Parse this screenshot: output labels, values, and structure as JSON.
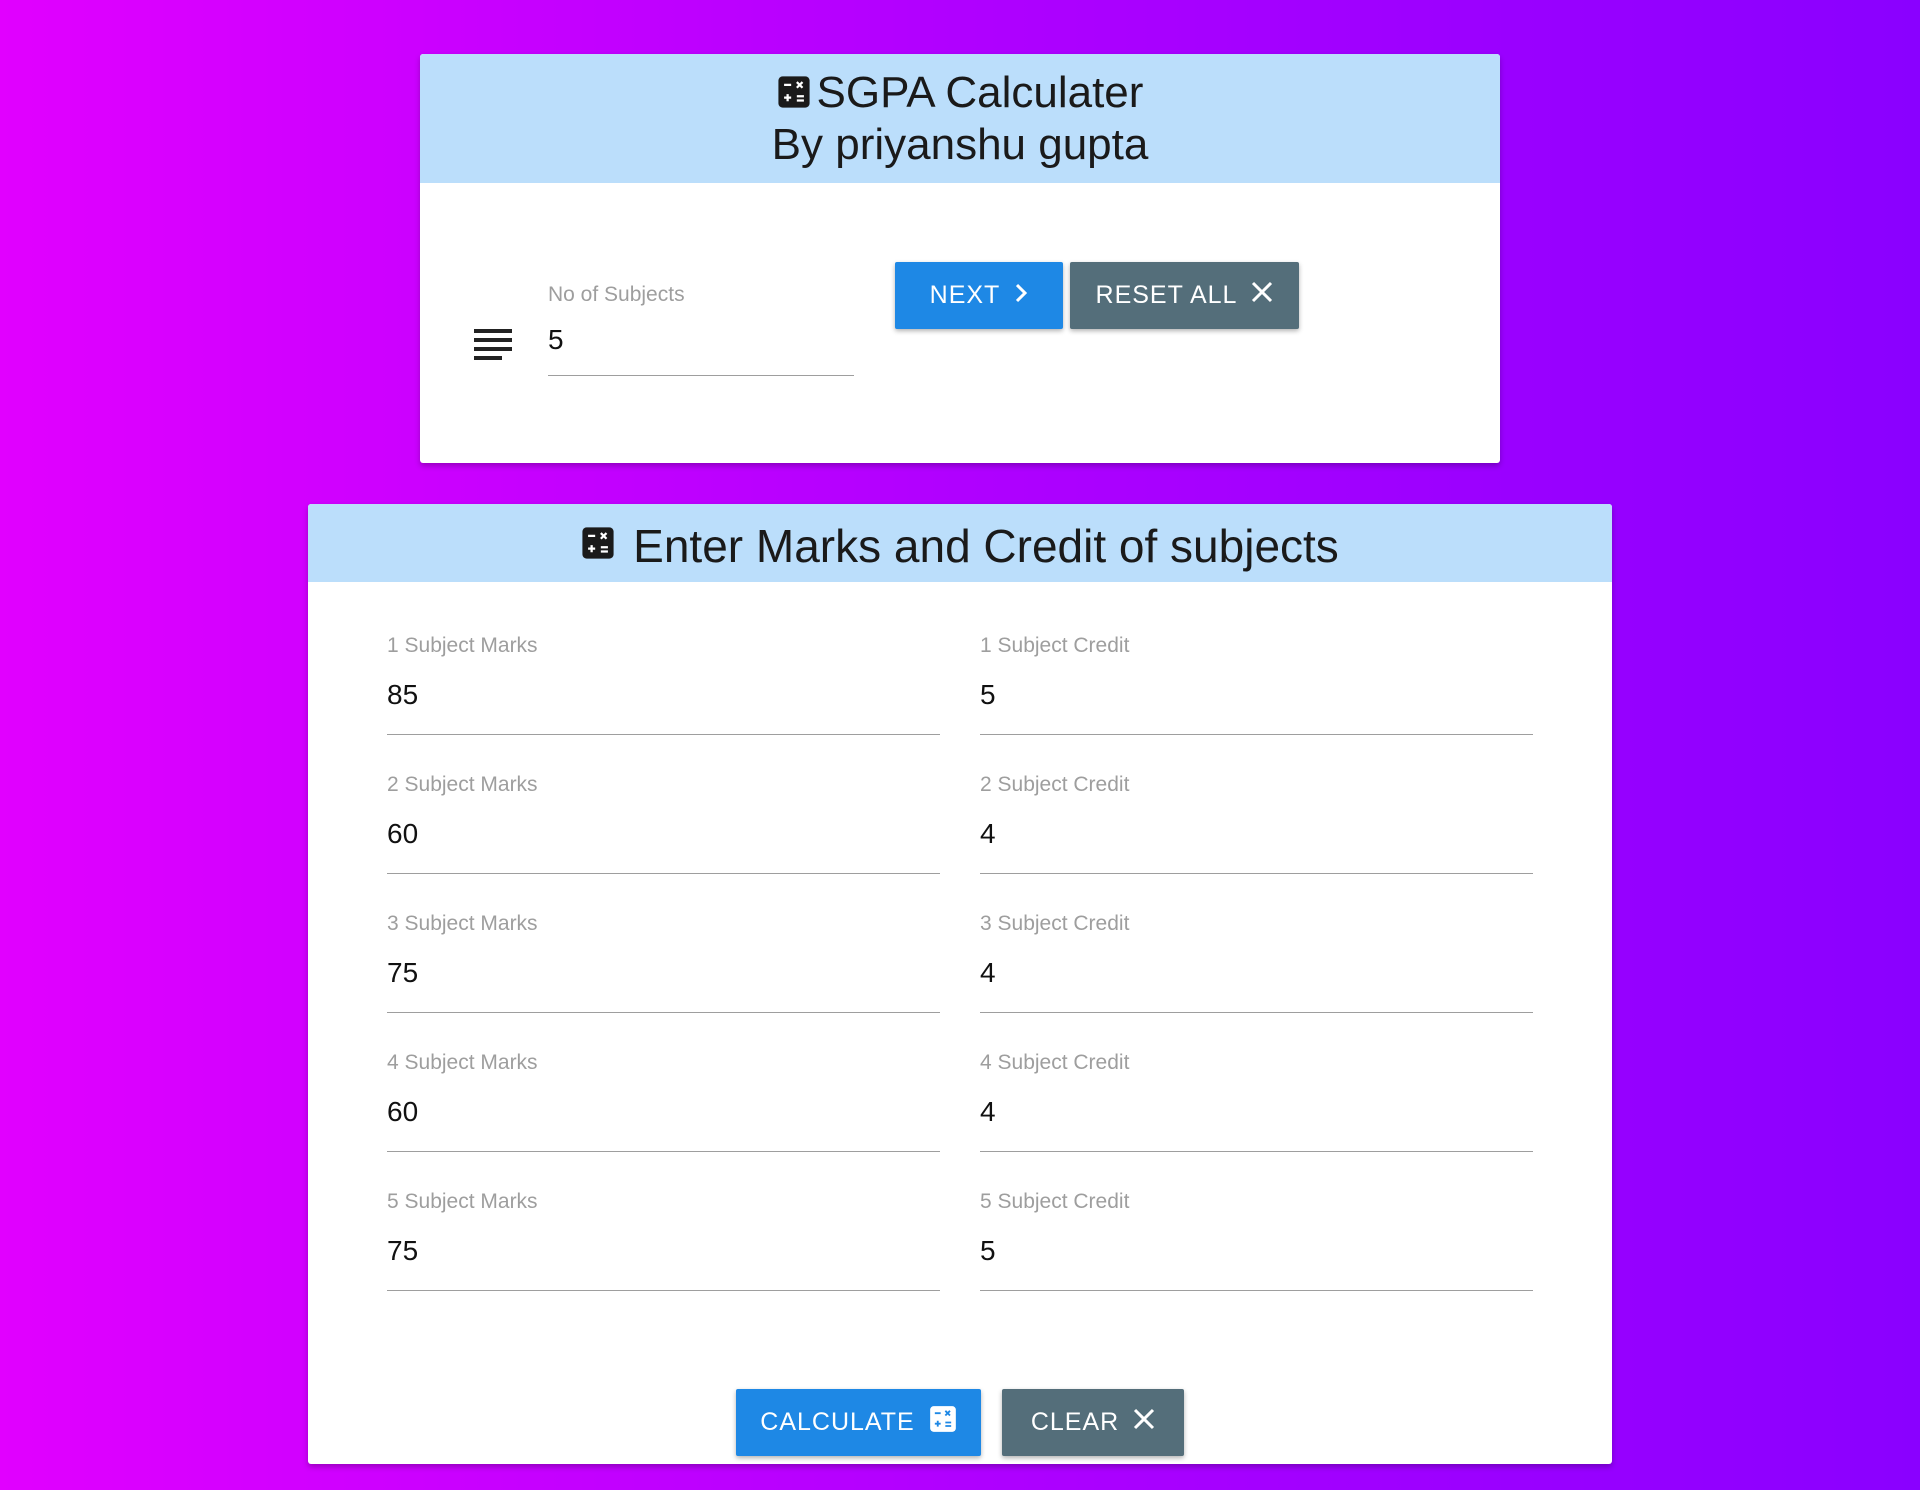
{
  "header": {
    "title": "SGPA Calculater",
    "subtitle": "By priyanshu gupta"
  },
  "subjects_count": {
    "label": "No of Subjects",
    "value": "5"
  },
  "buttons": {
    "next": "NEXT",
    "reset_all": "RESET ALL",
    "calculate": "CALCULATE",
    "clear": "CLEAR"
  },
  "entry": {
    "title": "Enter Marks and Credit of subjects",
    "rows": [
      {
        "marks_label": "1 Subject Marks",
        "marks": "85",
        "credit_label": "1 Subject Credit",
        "credit": "5"
      },
      {
        "marks_label": "2 Subject Marks",
        "marks": "60",
        "credit_label": "2 Subject Credit",
        "credit": "4"
      },
      {
        "marks_label": "3 Subject Marks",
        "marks": "75",
        "credit_label": "3 Subject Credit",
        "credit": "4"
      },
      {
        "marks_label": "4 Subject Marks",
        "marks": "60",
        "credit_label": "4 Subject Credit",
        "credit": "4"
      },
      {
        "marks_label": "5 Subject Marks",
        "marks": "75",
        "credit_label": "5 Subject Credit",
        "credit": "5"
      }
    ]
  },
  "icons": {
    "header": "calculator-icon",
    "count": "lines-icon",
    "next": "chevron-right-icon",
    "reset": "close-icon",
    "calculate": "calculator-icon",
    "clear": "close-icon"
  },
  "colors": {
    "background_start": "#e100ff",
    "background_end": "#8a00ff",
    "header_bg": "#bbdefb",
    "primary_button": "#1e88e5",
    "secondary_button": "#546e7a"
  }
}
